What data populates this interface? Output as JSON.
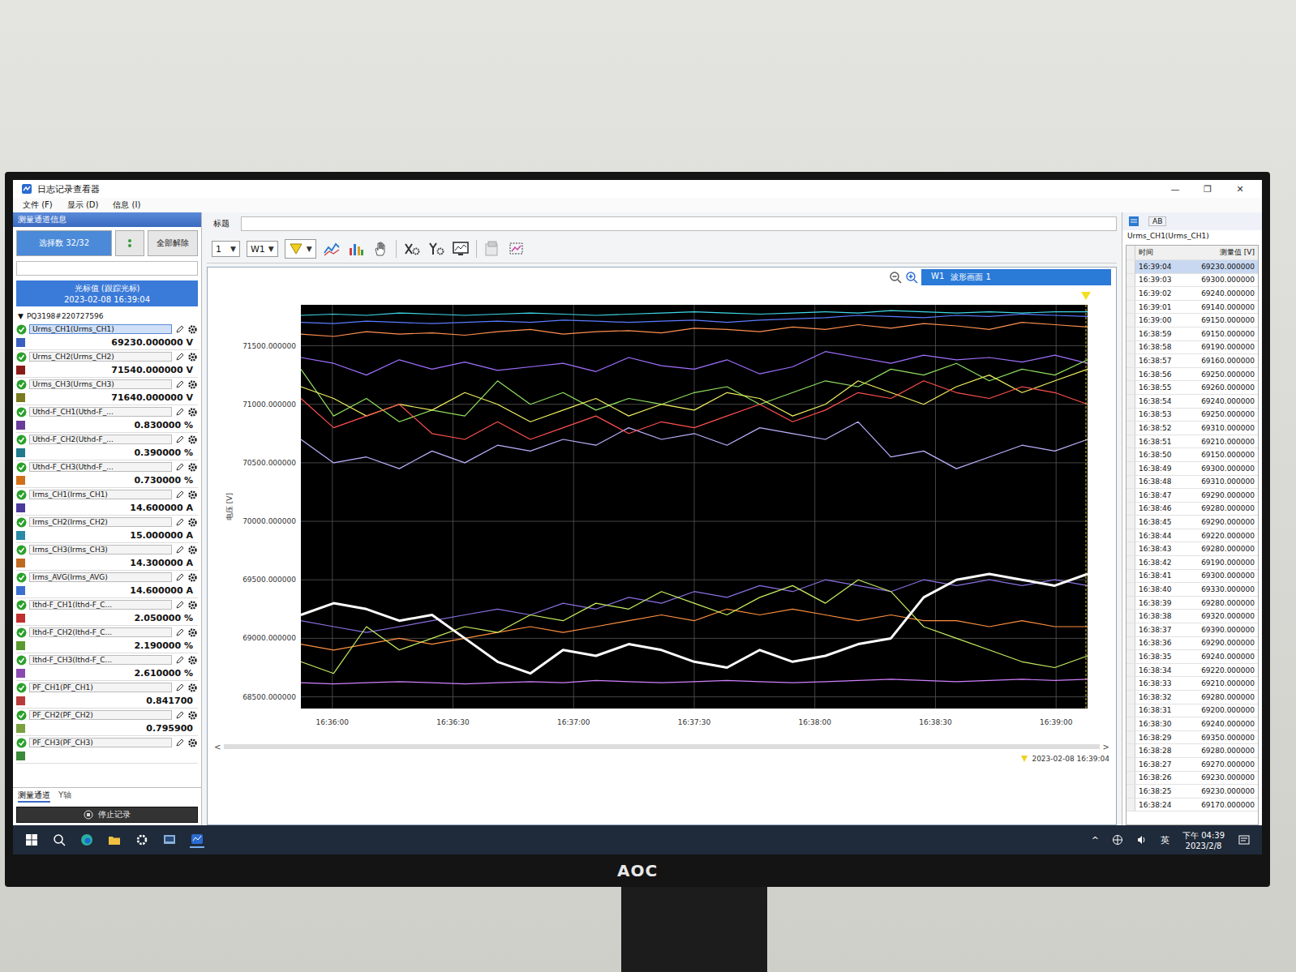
{
  "window": {
    "title": "日志记录查看器",
    "controls": [
      "—",
      "❐",
      "✕"
    ]
  },
  "menu": [
    {
      "label": "文件 (F)"
    },
    {
      "label": "显示 (D)"
    },
    {
      "label": "信息 (I)"
    }
  ],
  "left_panel": {
    "title": "测量通道信息",
    "select_button": "选择数 32/32",
    "clear_button": "全部解除",
    "cursor": {
      "title": "光标值 (跟踪光标)",
      "time": "2023-02-08 16:39:04"
    },
    "device": {
      "arrow": "▼",
      "label": "PQ3198#220727596",
      "expanded": true
    },
    "channels": [
      {
        "name": "Urms_CH1(Urms_CH1)",
        "value": "69230.000000 V",
        "checked": true,
        "selected": true,
        "color": "#3a5fc0"
      },
      {
        "name": "Urms_CH2(Urms_CH2)",
        "value": "71540.000000 V",
        "checked": true,
        "selected": false,
        "color": "#8b1a1a"
      },
      {
        "name": "Urms_CH3(Urms_CH3)",
        "value": "71640.000000 V",
        "checked": true,
        "selected": false,
        "color": "#7a7a20"
      },
      {
        "name": "Uthd-F_CH1(Uthd-F_...",
        "value": "0.830000 %",
        "checked": true,
        "selected": false,
        "color": "#6a3d9a"
      },
      {
        "name": "Uthd-F_CH2(Uthd-F_...",
        "value": "0.390000 %",
        "checked": true,
        "selected": false,
        "color": "#1f7a8c"
      },
      {
        "name": "Uthd-F_CH3(Uthd-F_...",
        "value": "0.730000 %",
        "checked": true,
        "selected": false,
        "color": "#d0701a"
      },
      {
        "name": "Irms_CH1(Irms_CH1)",
        "value": "14.600000 A",
        "checked": true,
        "selected": false,
        "color": "#4b3a9c"
      },
      {
        "name": "Irms_CH2(Irms_CH2)",
        "value": "15.000000 A",
        "checked": true,
        "selected": false,
        "color": "#2a8aa8"
      },
      {
        "name": "Irms_CH3(Irms_CH3)",
        "value": "14.300000 A",
        "checked": true,
        "selected": false,
        "color": "#c06a20"
      },
      {
        "name": "Irms_AVG(Irms_AVG)",
        "value": "14.600000 A",
        "checked": true,
        "selected": false,
        "color": "#3a6fd0"
      },
      {
        "name": "Ithd-F_CH1(Ithd-F_C...",
        "value": "2.050000 %",
        "checked": true,
        "selected": false,
        "color": "#c03030"
      },
      {
        "name": "Ithd-F_CH2(Ithd-F_C...",
        "value": "2.190000 %",
        "checked": true,
        "selected": false,
        "color": "#5a9a30"
      },
      {
        "name": "Ithd-F_CH3(Ithd-F_C...",
        "value": "2.610000 %",
        "checked": true,
        "selected": false,
        "color": "#8a4ab0"
      },
      {
        "name": "PF_CH1(PF_CH1)",
        "value": "0.841700",
        "checked": true,
        "selected": false,
        "color": "#b83a3a"
      },
      {
        "name": "PF_CH2(PF_CH2)",
        "value": "0.795900",
        "checked": true,
        "selected": false,
        "color": "#7aa040"
      },
      {
        "name": "PF_CH3(PF_CH3)",
        "checked": true,
        "selected": false,
        "color": "#3a8a3a"
      }
    ],
    "tabs": [
      {
        "label": "测量通道",
        "selected": true
      },
      {
        "label": "Y轴",
        "selected": false
      }
    ],
    "stop_button": "停止记录"
  },
  "toolbar": {
    "title_label": "标题",
    "dropdowns": [
      {
        "value": "1",
        "arrow": "▼"
      },
      {
        "value": "W1",
        "arrow": "▼"
      }
    ],
    "filter_arrow": "▼"
  },
  "chart": {
    "tab": {
      "id": "W1",
      "label": "波形画面 1",
      "selected": true
    },
    "y_label": "电压 [V]",
    "range": [
      68400,
      71850
    ],
    "y_ticks": [
      "71500.000000",
      "71000.000000",
      "70500.000000",
      "70000.000000",
      "69500.000000",
      "69000.000000",
      "68500.000000"
    ],
    "x_ticks": [
      "16:36:00",
      "16:36:30",
      "16:37:00",
      "16:37:30",
      "16:38:00",
      "16:38:30",
      "16:39:00"
    ],
    "scroll_arrows": [
      "<",
      ">"
    ],
    "cursor_time": "2023-02-08 16:39:04",
    "series": [
      {
        "color": "#40d8e8",
        "emphasized": false,
        "values": [
          71760,
          71770,
          71760,
          71780,
          71770,
          71760,
          71770,
          71780,
          71770,
          71760,
          71770,
          71780,
          71790,
          71780,
          71770,
          71780,
          71790,
          71780,
          71800,
          71790,
          71780,
          71790,
          71780,
          71790,
          71790
        ]
      },
      {
        "color": "#5a7cff",
        "emphasized": false,
        "values": [
          71700,
          71690,
          71710,
          71700,
          71690,
          71700,
          71710,
          71700,
          71720,
          71710,
          71700,
          71710,
          71720,
          71700,
          71720,
          71730,
          71740,
          71760,
          71750,
          71740,
          71760,
          71750,
          71770,
          71760,
          71750
        ]
      },
      {
        "color": "#ff9050",
        "emphasized": false,
        "values": [
          71600,
          71580,
          71620,
          71600,
          71610,
          71590,
          71620,
          71640,
          71600,
          71620,
          71630,
          71610,
          71650,
          71640,
          71620,
          71660,
          71640,
          71680,
          71650,
          71690,
          71670,
          71640,
          71700,
          71680,
          71660
        ]
      },
      {
        "color": "#a070ff",
        "emphasized": false,
        "values": [
          71400,
          71350,
          71250,
          71380,
          71300,
          71360,
          71290,
          71320,
          71350,
          71280,
          71400,
          71330,
          71300,
          71380,
          71260,
          71320,
          71450,
          71400,
          71350,
          71420,
          71380,
          71400,
          71360,
          71420,
          71350
        ]
      },
      {
        "color": "#c0b0ff",
        "emphasized": false,
        "values": [
          70700,
          70500,
          70550,
          70450,
          70600,
          70500,
          70650,
          70600,
          70700,
          70650,
          70800,
          70700,
          70750,
          70650,
          70800,
          70750,
          70700,
          70850,
          70550,
          70600,
          70450,
          70550,
          70650,
          70600,
          70700
        ]
      },
      {
        "color": "#90e060",
        "emphasized": false,
        "values": [
          71300,
          70900,
          71050,
          70850,
          70950,
          70900,
          71200,
          71000,
          71100,
          70950,
          71050,
          71000,
          71100,
          71150,
          71000,
          71100,
          71200,
          71150,
          71300,
          71250,
          71350,
          71200,
          71300,
          71250,
          71380
        ]
      },
      {
        "color": "#f0f060",
        "emphasized": false,
        "values": [
          71150,
          71050,
          70900,
          71000,
          70950,
          71100,
          71000,
          70850,
          70950,
          71050,
          70900,
          71000,
          70950,
          71100,
          71050,
          70900,
          71000,
          71200,
          71100,
          71000,
          71150,
          71250,
          71100,
          71200,
          71300
        ]
      },
      {
        "color": "#ff5050",
        "emphasized": false,
        "values": [
          71050,
          70800,
          70900,
          71000,
          70750,
          70700,
          70850,
          70700,
          70800,
          70900,
          70750,
          70850,
          70800,
          70900,
          71000,
          70850,
          70950,
          71100,
          71050,
          71200,
          71100,
          71050,
          71150,
          71100,
          71000
        ]
      },
      {
        "color": "#8a70e0",
        "emphasized": false,
        "values": [
          69150,
          69100,
          69050,
          69100,
          69150,
          69200,
          69250,
          69200,
          69300,
          69250,
          69350,
          69300,
          69400,
          69350,
          69450,
          69400,
          69500,
          69450,
          69400,
          69500,
          69450,
          69500,
          69450,
          69500,
          69450
        ]
      },
      {
        "color": "#ff9040",
        "emphasized": false,
        "values": [
          68950,
          68900,
          68950,
          69000,
          68950,
          69000,
          69050,
          69100,
          69050,
          69100,
          69150,
          69200,
          69150,
          69250,
          69200,
          69250,
          69200,
          69150,
          69200,
          69150,
          69150,
          69100,
          69150,
          69100,
          69100
        ]
      },
      {
        "color": "#c8f060",
        "emphasized": false,
        "values": [
          68800,
          68700,
          69100,
          68900,
          69000,
          69100,
          69050,
          69200,
          69150,
          69300,
          69250,
          69400,
          69300,
          69200,
          69350,
          69450,
          69300,
          69500,
          69400,
          69100,
          69000,
          68900,
          68800,
          68750,
          68850
        ]
      },
      {
        "color": "#d080ff",
        "emphasized": false,
        "values": [
          68620,
          68610,
          68620,
          68630,
          68620,
          68610,
          68620,
          68630,
          68620,
          68640,
          68630,
          68620,
          68630,
          68640,
          68630,
          68620,
          68630,
          68640,
          68650,
          68640,
          68630,
          68640,
          68650,
          68640,
          68650
        ]
      },
      {
        "color": "#ffffff",
        "emphasized": true,
        "values": [
          69200,
          69300,
          69250,
          69150,
          69200,
          69000,
          68800,
          68700,
          68900,
          68850,
          68950,
          68900,
          68800,
          68750,
          68900,
          68800,
          68850,
          68950,
          69000,
          69350,
          69500,
          69550,
          69500,
          69450,
          69550
        ]
      }
    ]
  },
  "right_panel": {
    "tab": "AB",
    "title": "Urms_CH1(Urms_CH1)",
    "columns": [
      "时间",
      "测量值 [V]"
    ],
    "rows": [
      {
        "time": "16:39:04",
        "value": "69230.000000",
        "selected": true
      },
      {
        "time": "16:39:03",
        "value": "69300.000000",
        "selected": false
      },
      {
        "time": "16:39:02",
        "value": "69240.000000",
        "selected": false
      },
      {
        "time": "16:39:01",
        "value": "69140.000000",
        "selected": false
      },
      {
        "time": "16:39:00",
        "value": "69150.000000",
        "selected": false
      },
      {
        "time": "16:38:59",
        "value": "69150.000000",
        "selected": false
      },
      {
        "time": "16:38:58",
        "value": "69190.000000",
        "selected": false
      },
      {
        "time": "16:38:57",
        "value": "69160.000000",
        "selected": false
      },
      {
        "time": "16:38:56",
        "value": "69250.000000",
        "selected": false
      },
      {
        "time": "16:38:55",
        "value": "69260.000000",
        "selected": false
      },
      {
        "time": "16:38:54",
        "value": "69240.000000",
        "selected": false
      },
      {
        "time": "16:38:53",
        "value": "69250.000000",
        "selected": false
      },
      {
        "time": "16:38:52",
        "value": "69310.000000",
        "selected": false
      },
      {
        "time": "16:38:51",
        "value": "69210.000000",
        "selected": false
      },
      {
        "time": "16:38:50",
        "value": "69150.000000",
        "selected": false
      },
      {
        "time": "16:38:49",
        "value": "69300.000000",
        "selected": false
      },
      {
        "time": "16:38:48",
        "value": "69310.000000",
        "selected": false
      },
      {
        "time": "16:38:47",
        "value": "69290.000000",
        "selected": false
      },
      {
        "time": "16:38:46",
        "value": "69280.000000",
        "selected": false
      },
      {
        "time": "16:38:45",
        "value": "69290.000000",
        "selected": false
      },
      {
        "time": "16:38:44",
        "value": "69220.000000",
        "selected": false
      },
      {
        "time": "16:38:43",
        "value": "69280.000000",
        "selected": false
      },
      {
        "time": "16:38:42",
        "value": "69190.000000",
        "selected": false
      },
      {
        "time": "16:38:41",
        "value": "69300.000000",
        "selected": false
      },
      {
        "time": "16:38:40",
        "value": "69330.000000",
        "selected": false
      },
      {
        "time": "16:38:39",
        "value": "69280.000000",
        "selected": false
      },
      {
        "time": "16:38:38",
        "value": "69320.000000",
        "selected": false
      },
      {
        "time": "16:38:37",
        "value": "69390.000000",
        "selected": false
      },
      {
        "time": "16:38:36",
        "value": "69290.000000",
        "selected": false
      },
      {
        "time": "16:38:35",
        "value": "69240.000000",
        "selected": false
      },
      {
        "time": "16:38:34",
        "value": "69220.000000",
        "selected": false
      },
      {
        "time": "16:38:33",
        "value": "69210.000000",
        "selected": false
      },
      {
        "time": "16:38:32",
        "value": "69280.000000",
        "selected": false
      },
      {
        "time": "16:38:31",
        "value": "69200.000000",
        "selected": false
      },
      {
        "time": "16:38:30",
        "value": "69240.000000",
        "selected": false
      },
      {
        "time": "16:38:29",
        "value": "69350.000000",
        "selected": false
      },
      {
        "time": "16:38:28",
        "value": "69280.000000",
        "selected": false
      },
      {
        "time": "16:38:27",
        "value": "69270.000000",
        "selected": false
      },
      {
        "time": "16:38:26",
        "value": "69230.000000",
        "selected": false
      },
      {
        "time": "16:38:25",
        "value": "69230.000000",
        "selected": false
      },
      {
        "time": "16:38:24",
        "value": "69170.000000",
        "selected": false
      }
    ]
  },
  "taskbar": {
    "tray_arrow": "^",
    "ime": "英",
    "time": "下午 04:39",
    "date": "2023/2/8"
  },
  "monitor": {
    "brand": "AOC"
  }
}
